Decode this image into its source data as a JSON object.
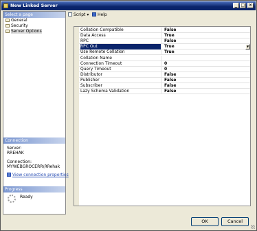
{
  "window": {
    "title": "New Linked Server"
  },
  "sidebar": {
    "select_page_header": "Select a page",
    "pages": [
      {
        "label": "General"
      },
      {
        "label": "Security"
      },
      {
        "label": "Server Options",
        "selected": true
      }
    ],
    "connection_header": "Connection",
    "server_label": "Server:",
    "server_value": "RREHAK",
    "connection_label": "Connection:",
    "connection_value": "MYWEBGROCERR\\RRehak",
    "view_connection_properties": "View connection properties",
    "progress_header": "Progress",
    "progress_status": "Ready"
  },
  "toolbar": {
    "script_label": "Script",
    "help_label": "Help"
  },
  "properties": [
    {
      "name": "Collation Compatible",
      "value": "False"
    },
    {
      "name": "Data Access",
      "value": "True"
    },
    {
      "name": "RPC",
      "value": "False"
    },
    {
      "name": "RPC Out",
      "value": "True",
      "selected": true
    },
    {
      "name": "Use Remote Collation",
      "value": "True"
    },
    {
      "name": "Collation Name",
      "value": ""
    },
    {
      "name": "Connection Timeout",
      "value": "0"
    },
    {
      "name": "Query Timeout",
      "value": "0"
    },
    {
      "name": "Distributor",
      "value": "False"
    },
    {
      "name": "Publisher",
      "value": "False"
    },
    {
      "name": "Subscriber",
      "value": "False"
    },
    {
      "name": "Lazy Schema Validation",
      "value": "False"
    }
  ],
  "buttons": {
    "ok": "OK",
    "cancel": "Cancel"
  },
  "colors": {
    "titlebar": "#0a246a",
    "selection": "#0a246a",
    "section_header": "#7a96d0",
    "link": "#2a4fb4"
  },
  "icons": {
    "window": "linked-server-icon",
    "script": "script-icon",
    "help": "help-icon"
  }
}
